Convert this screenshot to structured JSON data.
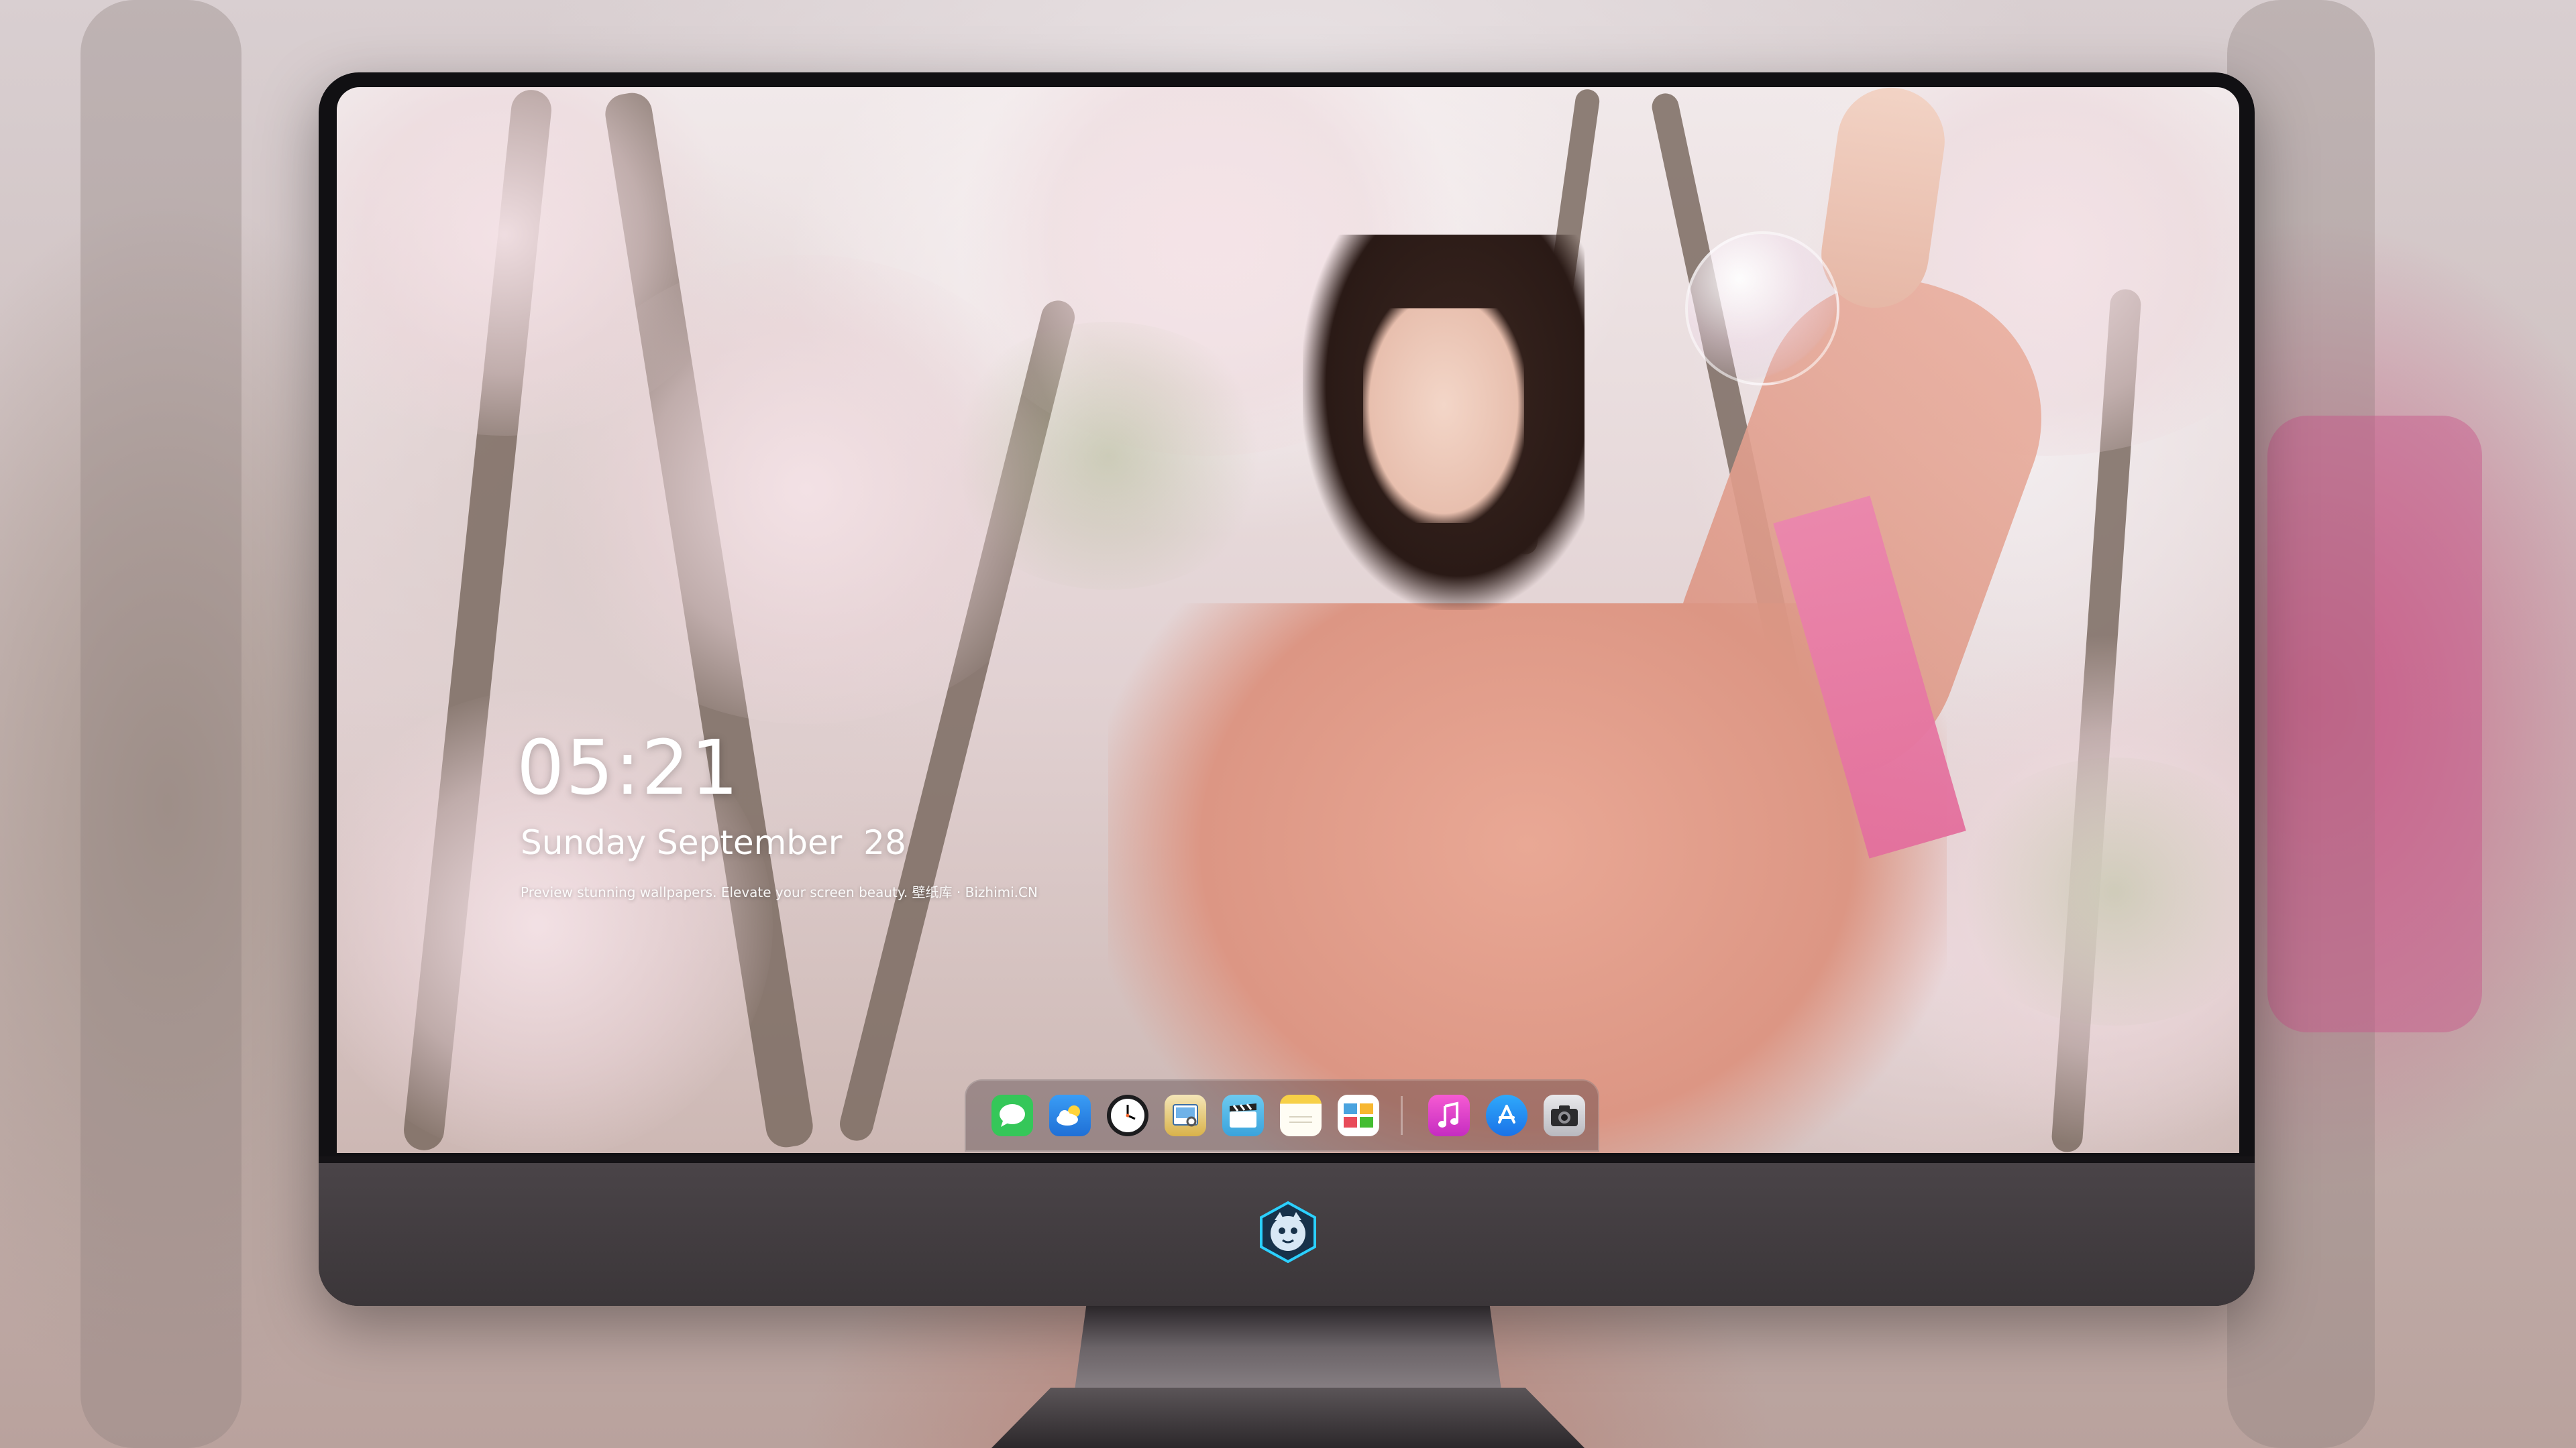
{
  "lock_screen": {
    "time": "05:21",
    "date": "Sunday September  28",
    "tagline": "Preview stunning wallpapers. Elevate your screen beauty. 壁纸库 · Bizhimi.CN"
  },
  "dock": {
    "apps": [
      {
        "name": "messages",
        "icon": "messages-icon",
        "color": "#35c759"
      },
      {
        "name": "weather",
        "icon": "weather-icon",
        "color": "#2f8ef0"
      },
      {
        "name": "clock",
        "icon": "clock-icon",
        "color": "#1c1c1e"
      },
      {
        "name": "preview",
        "icon": "preview-icon",
        "color": "#d9b24a"
      },
      {
        "name": "clips",
        "icon": "clips-icon",
        "color": "#4fb6e8"
      },
      {
        "name": "notes",
        "icon": "notes-icon",
        "color": "#f7d047"
      },
      {
        "name": "photo-booth",
        "icon": "photo-booth-icon",
        "color": "#4aa3df"
      },
      {
        "name": "music",
        "icon": "music-icon",
        "color": "#e84bd1"
      },
      {
        "name": "app-store",
        "icon": "app-store-icon",
        "color": "#1e8ef7"
      },
      {
        "name": "camera",
        "icon": "camera-icon",
        "color": "#3a3a3c"
      }
    ]
  },
  "colors": {
    "monitor_bezel": "#111013",
    "monitor_chin": "#3b3639",
    "shirt": "#e9a895",
    "tag": "#e36f9d"
  }
}
